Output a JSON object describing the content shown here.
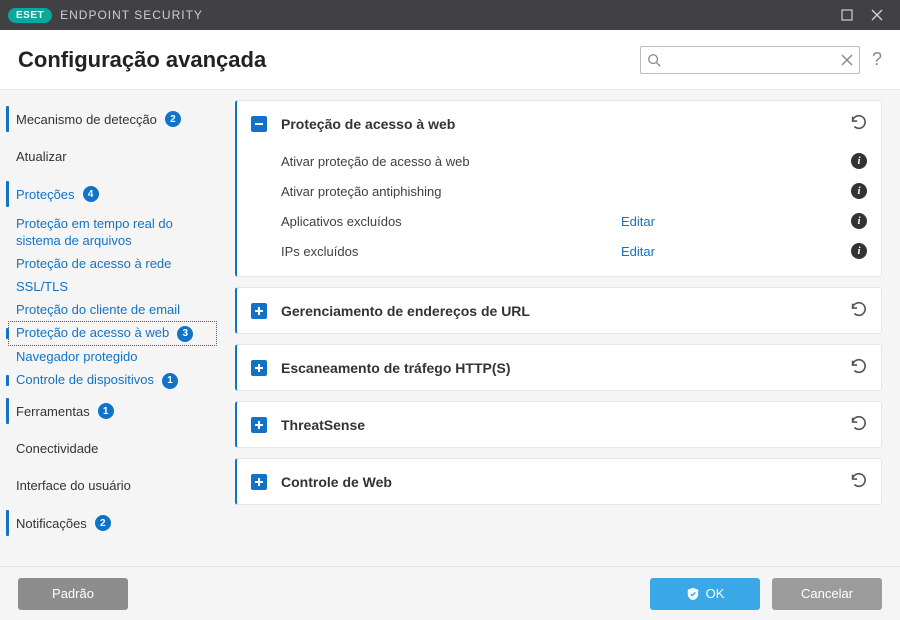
{
  "titlebar": {
    "app": "ESET",
    "product": "ENDPOINT SECURITY"
  },
  "header": {
    "title": "Configuração avançada",
    "search_placeholder": ""
  },
  "sidebar": {
    "detection": {
      "label": "Mecanismo de detecção",
      "badge": "2"
    },
    "update": {
      "label": "Atualizar"
    },
    "protections": {
      "label": "Proteções",
      "badge": "4"
    },
    "sub": {
      "rtfs": {
        "label": "Proteção em tempo real do sistema de arquivos"
      },
      "net": {
        "label": "Proteção de acesso à rede"
      },
      "ssl": {
        "label": "SSL/TLS"
      },
      "email": {
        "label": "Proteção do cliente de email"
      },
      "web": {
        "label": "Proteção de acesso à web",
        "badge": "3"
      },
      "browser": {
        "label": "Navegador protegido"
      },
      "device": {
        "label": "Controle de dispositivos",
        "badge": "1"
      }
    },
    "tools": {
      "label": "Ferramentas",
      "badge": "1"
    },
    "connectivity": {
      "label": "Conectividade"
    },
    "ui": {
      "label": "Interface do usuário"
    },
    "notifications": {
      "label": "Notificações",
      "badge": "2"
    }
  },
  "panels": {
    "web": {
      "title": "Proteção de acesso à web",
      "rows": {
        "enable_web": {
          "label": "Ativar proteção de acesso à web",
          "on": true
        },
        "enable_phish": {
          "label": "Ativar proteção antiphishing",
          "on": true
        },
        "excluded_apps": {
          "label": "Aplicativos excluídos",
          "action": "Editar"
        },
        "excluded_ips": {
          "label": "IPs excluídos",
          "action": "Editar"
        }
      }
    },
    "url_mgmt": {
      "title": "Gerenciamento de endereços de URL"
    },
    "http_scan": {
      "title": "Escaneamento de tráfego HTTP(S)"
    },
    "threatsense": {
      "title": "ThreatSense"
    },
    "webcontrol": {
      "title": "Controle de Web"
    }
  },
  "footer": {
    "default": "Padrão",
    "ok": "OK",
    "cancel": "Cancelar"
  }
}
